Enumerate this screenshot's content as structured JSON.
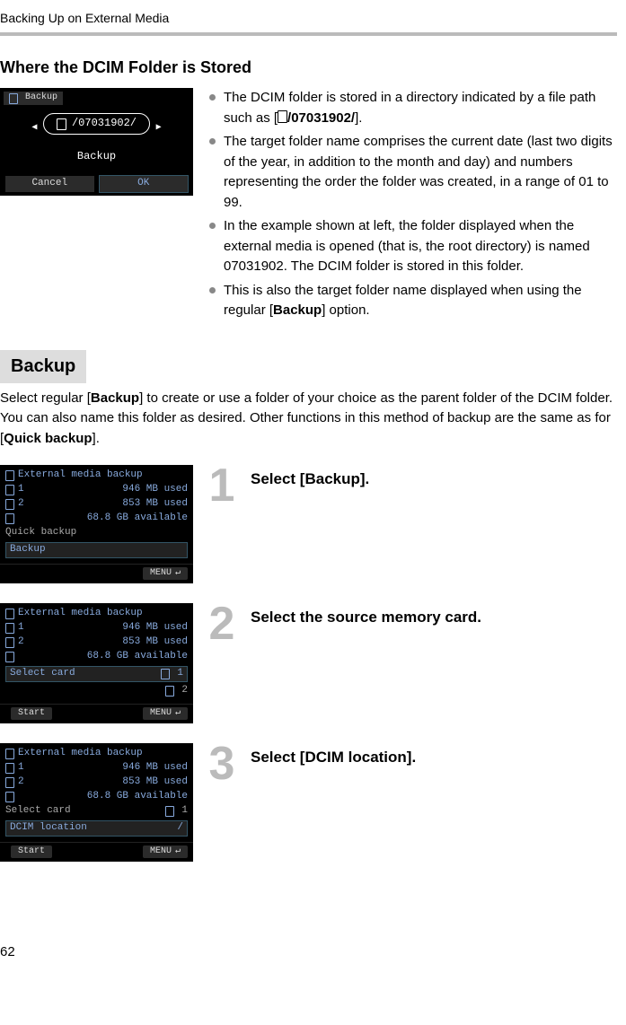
{
  "header": {
    "title": "Backing Up on External Media"
  },
  "section1": {
    "title": "Where the DCIM Folder is Stored",
    "lcd": {
      "tab": "Backup",
      "path": "/07031902/",
      "label": "Backup",
      "cancel": "Cancel",
      "ok": "OK"
    },
    "bullets": {
      "b1a": "The DCIM folder is stored in a directory indicated by a file path such as [",
      "b1b": "/07031902/",
      "b1c": "].",
      "b2": "The target folder name comprises the current date (last two digits of the year, in addition to the month and day) and numbers representing the order the folder was created, in a range of 01 to 99.",
      "b3": "In the example shown at left, the folder displayed when the external media is opened (that is, the root directory) is named 07031902. The DCIM folder is stored in this folder.",
      "b4a": "This is also the target folder name displayed when using the regular [",
      "b4b": "Backup",
      "b4c": "] option."
    }
  },
  "section2": {
    "tab": "Backup",
    "intro_a": "Select regular [",
    "intro_b": "Backup",
    "intro_c": "] to create or use a folder of your choice as the parent folder of the DCIM folder. You can also name this folder as desired. Other functions in this method of backup are the same as for [",
    "intro_d": "Quick backup",
    "intro_e": "]."
  },
  "lcd_common": {
    "title": "External media backup",
    "slot1": "1",
    "slot2": "2",
    "used1": "946 MB used",
    "used2": "853 MB used",
    "avail": "68.8 GB available",
    "quick": "Quick backup",
    "backup": "Backup",
    "selectcard": "Select card",
    "dcimloc": "DCIM location",
    "start": "Start",
    "menu": "MENU",
    "slash": "/"
  },
  "steps": {
    "s1": {
      "num": "1",
      "text": "Select [Backup]."
    },
    "s2": {
      "num": "2",
      "text": "Select the source memory card."
    },
    "s3": {
      "num": "3",
      "text": "Select [DCIM location]."
    }
  },
  "page": "62"
}
